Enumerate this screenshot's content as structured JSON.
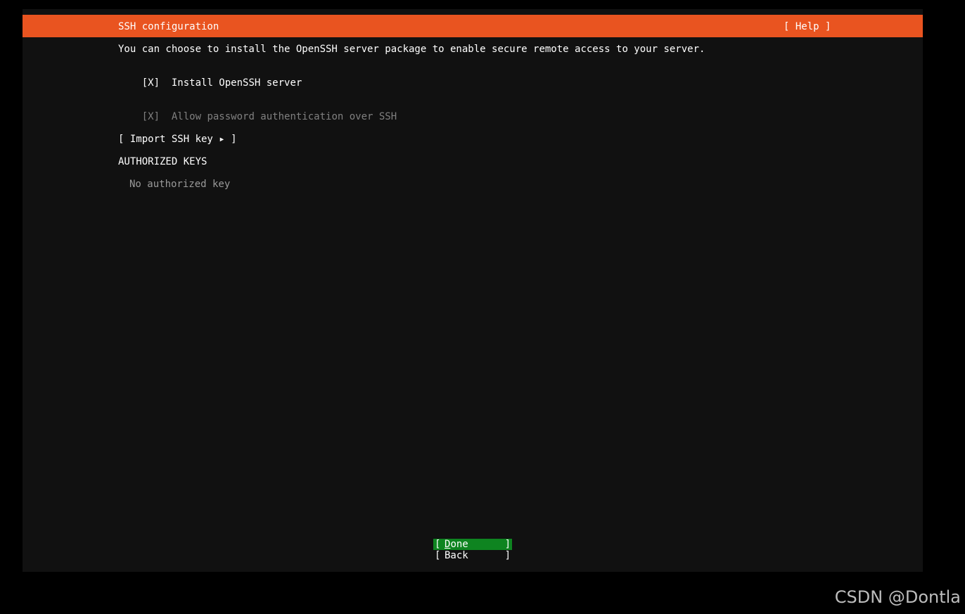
{
  "header": {
    "title": "SSH configuration",
    "help_label": "[ Help ]"
  },
  "body": {
    "intro": "You can choose to install the OpenSSH server package to enable secure remote access to your server.",
    "install_checkbox": {
      "mark": "[X]",
      "label": "Install OpenSSH server",
      "checked": true
    },
    "password_checkbox": {
      "mark": "[X]",
      "label": "Allow password authentication over SSH",
      "checked": true,
      "disabled": true
    },
    "import_key_label": "[ Import SSH key ▸ ]",
    "authorized_keys_heading": "AUTHORIZED KEYS",
    "no_keys_text": "No authorized key"
  },
  "buttons": {
    "open_bracket": "[",
    "close_bracket": "]",
    "done_hotkey": "D",
    "done_rest": "one",
    "back_label": "Back"
  },
  "watermark": "CSDN @Dontla",
  "colors": {
    "accent": "#e95420",
    "focus_button": "#0e8420",
    "background": "#111111"
  }
}
